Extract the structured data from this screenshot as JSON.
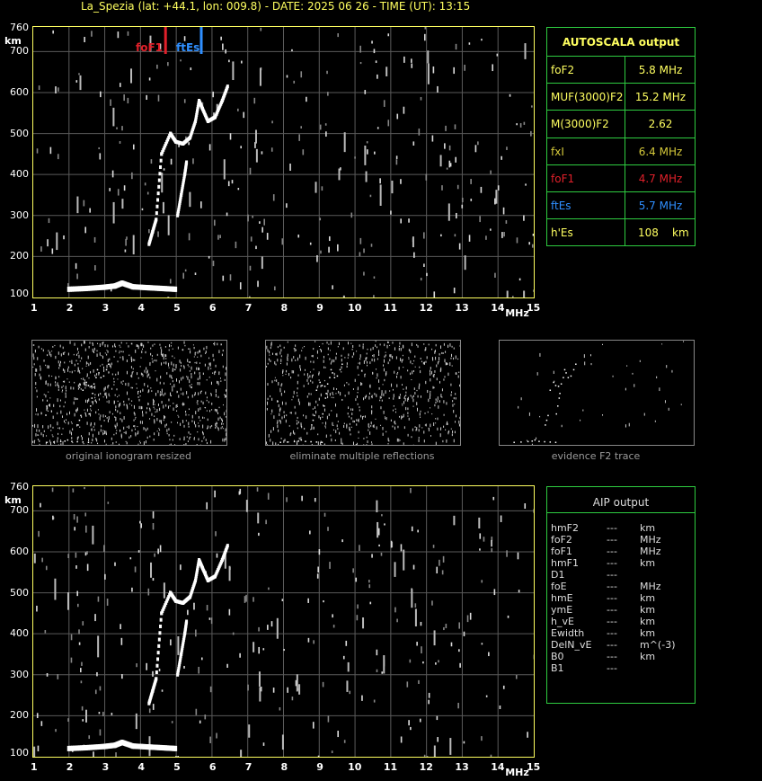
{
  "title": "La_Spezia (lat: +44.1, lon: 009.8) - DATE: 2025 06 26 - TIME (UT): 13:15",
  "colors": {
    "frame": "#ffff60",
    "panel_border": "#2ecc40",
    "foF1": "#e0202a",
    "ftEs": "#2f8fff",
    "fxI": "#d4c83a"
  },
  "axes": {
    "y_unit": "km",
    "x_unit": "MHz",
    "y_ticks": [
      "760",
      "700",
      "600",
      "500",
      "400",
      "300",
      "200",
      "100"
    ],
    "x_ticks": [
      "1",
      "2",
      "3",
      "4",
      "5",
      "6",
      "7",
      "8",
      "9",
      "10",
      "11",
      "12",
      "13",
      "14",
      "15"
    ]
  },
  "markers": {
    "foF1_label": "foF1",
    "ftEs_label": "ftEs"
  },
  "autoscala": {
    "title": "AUTOSCALA output",
    "rows": [
      {
        "key": "foF2",
        "value": "5.8 MHz"
      },
      {
        "key": "MUF(3000)F2",
        "value": "15.2 MHz"
      },
      {
        "key": "M(3000)F2",
        "value": "2.62"
      },
      {
        "key": "fxI",
        "value": "6.4 MHz"
      },
      {
        "key": "foF1",
        "value": "4.7 MHz"
      },
      {
        "key": "ftEs",
        "value": "5.7 MHz"
      },
      {
        "key": "h'Es",
        "value": "108",
        "unit": "km"
      }
    ]
  },
  "thumbnails": [
    {
      "caption": "original ionogram resized"
    },
    {
      "caption": "eliminate multiple reflections"
    },
    {
      "caption": "evidence F2 trace"
    }
  ],
  "aip": {
    "title": "AIP output",
    "rows": [
      {
        "name": "hmF2",
        "val": "---",
        "unit": "km"
      },
      {
        "name": "foF2",
        "val": "---",
        "unit": "MHz"
      },
      {
        "name": "foF1",
        "val": "---",
        "unit": "MHz"
      },
      {
        "name": "hmF1",
        "val": "---",
        "unit": "km"
      },
      {
        "name": "D1",
        "val": "---",
        "unit": ""
      },
      {
        "name": "foE",
        "val": "---",
        "unit": "MHz"
      },
      {
        "name": "hmE",
        "val": "---",
        "unit": "km"
      },
      {
        "name": "ymE",
        "val": "---",
        "unit": "km"
      },
      {
        "name": "h_vE",
        "val": "---",
        "unit": "km"
      },
      {
        "name": "Ewidth",
        "val": "---",
        "unit": "km"
      },
      {
        "name": "DelN_vE",
        "val": "---",
        "unit": "m^(-3)"
      },
      {
        "name": "B0",
        "val": "---",
        "unit": "km"
      },
      {
        "name": "B1",
        "val": "---",
        "unit": ""
      }
    ]
  },
  "chart_data": [
    {
      "type": "scatter",
      "title": "",
      "xlabel": "MHz",
      "ylabel": "km",
      "xlim": [
        1,
        15
      ],
      "ylim": [
        100,
        760
      ],
      "grid": true,
      "series": [
        {
          "name": "",
          "points": [
            [
              2.0,
              120
            ],
            [
              2.5,
              122
            ],
            [
              3.0,
              125
            ],
            [
              3.3,
              128
            ],
            [
              3.5,
              135
            ],
            [
              3.8,
              126
            ],
            [
              4.2,
              124
            ],
            [
              4.6,
              122
            ],
            [
              5.0,
              120
            ]
          ]
        },
        {
          "name": "",
          "points": [
            [
              4.25,
              230
            ],
            [
              4.35,
              260
            ],
            [
              4.45,
              290
            ],
            [
              4.6,
              450
            ],
            [
              4.85,
              500
            ],
            [
              5.0,
              480
            ],
            [
              5.2,
              475
            ],
            [
              5.4,
              490
            ],
            [
              5.55,
              530
            ],
            [
              5.65,
              580
            ],
            [
              5.75,
              560
            ],
            [
              5.9,
              530
            ],
            [
              6.1,
              540
            ],
            [
              6.3,
              580
            ],
            [
              6.45,
              615
            ]
          ]
        },
        {
          "name": "",
          "points": [
            [
              5.05,
              300
            ],
            [
              5.15,
              350
            ],
            [
              5.25,
              400
            ],
            [
              5.3,
              430
            ]
          ]
        }
      ],
      "markers": [
        {
          "label": "foF1",
          "x": 4.7
        },
        {
          "label": "ftEs",
          "x": 5.7
        }
      ]
    },
    {
      "type": "scatter",
      "title": "",
      "xlabel": "MHz",
      "ylabel": "km",
      "xlim": [
        1,
        15
      ],
      "ylim": [
        100,
        760
      ],
      "grid": true,
      "series": [
        {
          "name": "",
          "points": [
            [
              2.0,
              120
            ],
            [
              2.5,
              122
            ],
            [
              3.0,
              125
            ],
            [
              3.3,
              128
            ],
            [
              3.5,
              135
            ],
            [
              3.8,
              126
            ],
            [
              4.2,
              124
            ],
            [
              4.6,
              122
            ],
            [
              5.0,
              120
            ]
          ]
        },
        {
          "name": "",
          "points": [
            [
              4.25,
              230
            ],
            [
              4.35,
              260
            ],
            [
              4.45,
              290
            ],
            [
              4.6,
              450
            ],
            [
              4.85,
              500
            ],
            [
              5.0,
              480
            ],
            [
              5.2,
              475
            ],
            [
              5.4,
              490
            ],
            [
              5.55,
              530
            ],
            [
              5.65,
              580
            ],
            [
              5.75,
              560
            ],
            [
              5.9,
              530
            ],
            [
              6.1,
              540
            ],
            [
              6.3,
              580
            ],
            [
              6.45,
              615
            ]
          ]
        },
        {
          "name": "",
          "points": [
            [
              5.05,
              300
            ],
            [
              5.15,
              350
            ],
            [
              5.25,
              400
            ],
            [
              5.3,
              430
            ]
          ]
        }
      ]
    }
  ]
}
